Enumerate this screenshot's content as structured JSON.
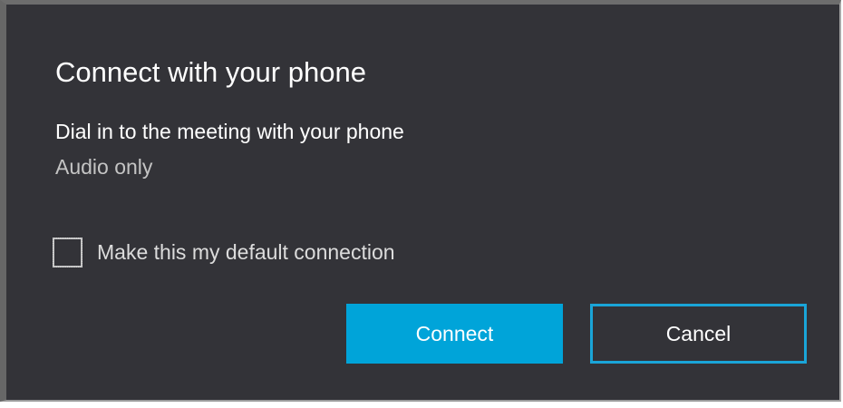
{
  "dialog": {
    "title": "Connect with your phone",
    "subtitle": "Dial in to the meeting with your phone",
    "secondary": "Audio only",
    "checkbox": {
      "label": "Make this my default connection",
      "checked": false
    },
    "buttons": {
      "connect": "Connect",
      "cancel": "Cancel"
    },
    "colors": {
      "background": "#333338",
      "accent": "#00a4d9",
      "text_primary": "#ffffff",
      "text_secondary": "#c4c4c4"
    }
  }
}
